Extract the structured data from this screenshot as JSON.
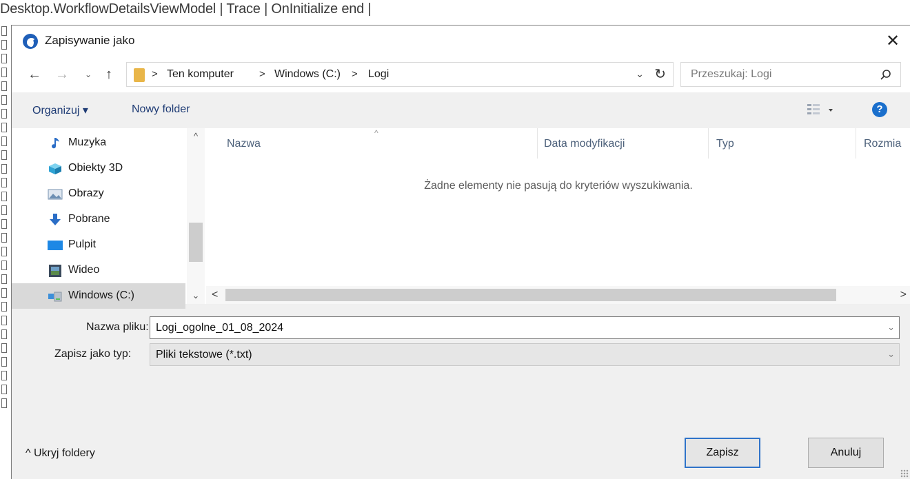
{
  "background": {
    "log_line": "Desktop.WorkflowDetailsViewModel | Trace | OnInitialize end |"
  },
  "dialog": {
    "title": "Zapisywanie jako",
    "close_label": "✕",
    "address": {
      "crumbs": [
        "Ten komputer",
        "Windows (C:)",
        "Logi"
      ],
      "separator": ">"
    },
    "search": {
      "placeholder": "Przeszukaj: Logi"
    },
    "toolbar": {
      "organize_label": "Organizuj ▾",
      "new_folder_label": "Nowy folder",
      "help_label": "?"
    },
    "nav": {
      "items": [
        {
          "label": "Muzyka",
          "icon": "music-icon"
        },
        {
          "label": "Obiekty 3D",
          "icon": "cube-3d-icon"
        },
        {
          "label": "Obrazy",
          "icon": "pictures-icon"
        },
        {
          "label": "Pobrane",
          "icon": "download-icon"
        },
        {
          "label": "Pulpit",
          "icon": "desktop-icon"
        },
        {
          "label": "Wideo",
          "icon": "video-icon"
        },
        {
          "label": "Windows (C:)",
          "icon": "drive-icon",
          "selected": true
        }
      ]
    },
    "list": {
      "columns": [
        "Nazwa",
        "Data modyfikacji",
        "Typ",
        "Rozmia"
      ],
      "empty_message": "Żadne elementy nie pasują do kryteriów wyszukiwania."
    },
    "filename": {
      "label": "Nazwa pliku:",
      "value": "Logi_ogolne_01_08_2024"
    },
    "filetype": {
      "label": "Zapisz jako typ:",
      "value": "Pliki tekstowe (*.txt)"
    },
    "hide_folders_label": "^ Ukryj foldery",
    "save_label": "Zapisz",
    "cancel_label": "Anuluj"
  },
  "colors": {
    "accent": "#2f73c9",
    "help": "#1a6fcc",
    "folder": "#e9b649"
  }
}
